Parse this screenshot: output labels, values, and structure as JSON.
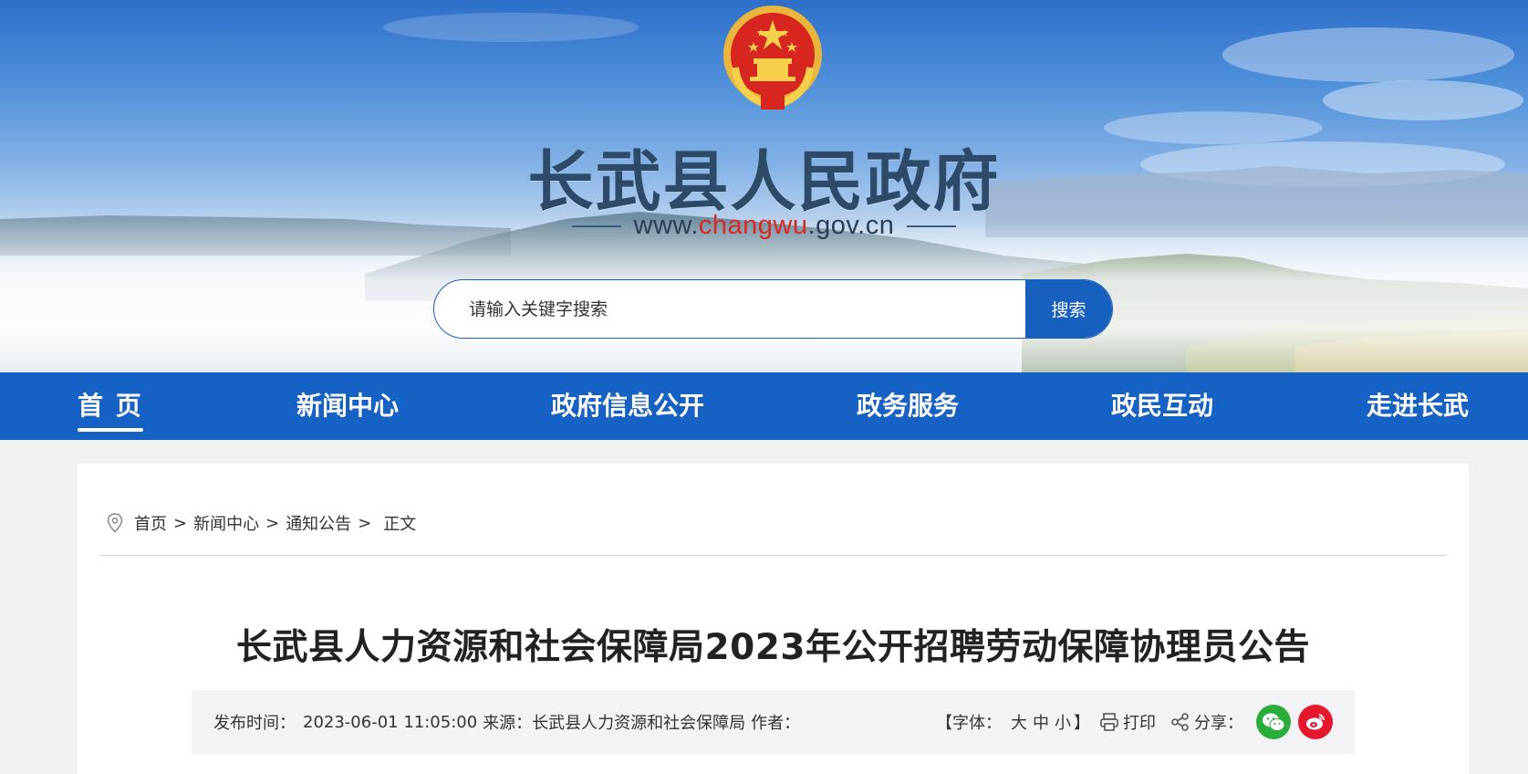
{
  "header": {
    "site_title": "长武县人民政府",
    "url_prefix": "www.",
    "url_highlight": "changwu",
    "url_suffix": ".gov.cn"
  },
  "search": {
    "placeholder": "请输入关键字搜索",
    "button_label": "搜索"
  },
  "nav": {
    "items": [
      {
        "label": "首  页",
        "active": true
      },
      {
        "label": "新闻中心"
      },
      {
        "label": "政府信息公开"
      },
      {
        "label": "政务服务"
      },
      {
        "label": "政民互动"
      },
      {
        "label": "走进长武"
      }
    ]
  },
  "breadcrumb": {
    "items": [
      "首页",
      "新闻中心",
      "通知公告"
    ],
    "separator": ">",
    "current": "正文"
  },
  "article": {
    "title": "长武县人力资源和社会保障局2023年公开招聘劳动保障协理员公告",
    "meta": {
      "publish_label": "发布时间：",
      "publish_time": "2023-06-01 11:05:00",
      "source_label": "来源：",
      "source": "长武县人力资源和社会保障局",
      "author_label": "作者：",
      "author": "",
      "font_open": "【字体：",
      "font_sizes": [
        "大",
        "中",
        "小"
      ],
      "font_close": "】",
      "print_label": "打印",
      "share_label": "分享："
    }
  },
  "colors": {
    "nav_bg": "#1561c4",
    "accent": "#1760bd",
    "url_red": "#d9281f",
    "wechat": "#2bad3b",
    "weibo": "#e6162d"
  },
  "icons": {
    "breadcrumb": "location-pin-icon",
    "print": "printer-icon",
    "share": "share-icon",
    "wechat": "wechat-icon",
    "weibo": "weibo-icon",
    "emblem": "national-emblem"
  }
}
